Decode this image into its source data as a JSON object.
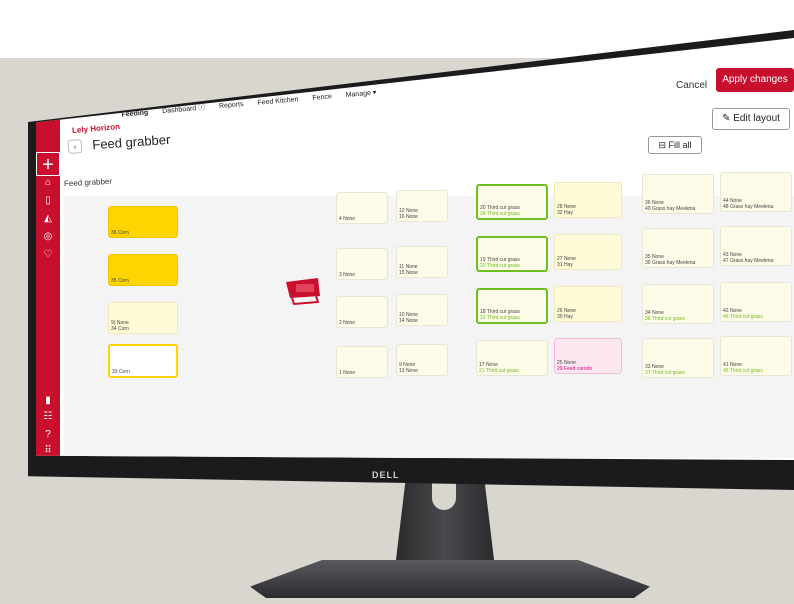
{
  "header": {
    "brand": "Lely Horizon",
    "nav": [
      "Feeding",
      "Dashboard ⓘ",
      "Reports",
      "Feed Kitchen",
      "Fence",
      "Manage ▾"
    ],
    "cancel_label": "Cancel",
    "apply_label": "Apply changes"
  },
  "page": {
    "back_label": "‹",
    "title": "Feed grabber",
    "section_label": "Feed grabber",
    "fill_all_label": "Fill all",
    "edit_layout_label": "Edit layout"
  },
  "monitor": {
    "brand": "DELL"
  },
  "cards": {
    "c36": "36 Corn",
    "c35": "35 Corn",
    "c34": "34 Corn",
    "c33": "33 Corn",
    "c9n": "9( None",
    "c12": "12 None",
    "c16": "16 None",
    "c4": "4 None",
    "c11": "11 None",
    "c15": "15 None",
    "c3": "3 None",
    "c10": "10 None",
    "c14": "14 None",
    "c2": "2 None",
    "c9": "9 None",
    "c13": "13 None",
    "c1": "1 None",
    "c20": "20 Third cut grass",
    "c24": "24 Third cut grass",
    "c28": "28 None",
    "c32": "32 Hay",
    "c19": "19 Third cut grass",
    "c23": "23 Third cut grass",
    "c27": "27 None",
    "c31": "31 Hay",
    "c18": "18 Third cut grass",
    "c22": "22 Third cut grass",
    "c26": "26 None",
    "c30": "30 Hay",
    "c17": "17 None",
    "c21": "21 Third cut grass",
    "c25": "25 None",
    "c29": "29 Feed carrots",
    "c36b": "36 None",
    "c40": "40 Grass hay Meekma",
    "c44": "44 None",
    "c48": "48 Grass hay Meekma",
    "c35b": "35 None",
    "c39": "39 Grass hay Meekma",
    "c43": "43 None",
    "c47": "47 Grass hay Meekma",
    "c34b": "34 None",
    "c38": "38 Third cut grass",
    "c42": "42 None",
    "c46": "46 Third cut grass",
    "c33b": "33 None",
    "c37": "37 Third cut grass",
    "c41": "41 None",
    "c45": "45 Third cut grass"
  },
  "colors": {
    "brand_red": "#c8102e",
    "corn_yellow": "#ffd400",
    "grass_green": "#8cc63f",
    "carrot_pink": "#e6007e"
  }
}
